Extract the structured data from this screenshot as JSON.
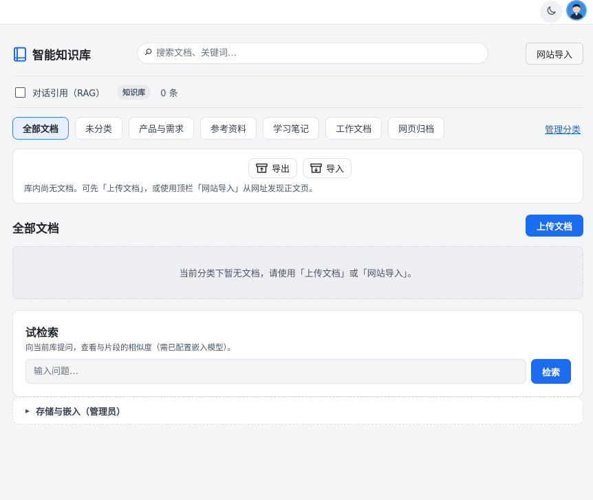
{
  "topbar": {
    "theme_icon": "moon-icon",
    "avatar_icon": "user-avatar"
  },
  "header": {
    "title": "智能知识库",
    "logo_icon": "book-icon",
    "search_placeholder": "搜索文档、关键词…",
    "search_icon": "search-icon",
    "site_import_label": "网站导入"
  },
  "rag": {
    "label": "对话引用（RAG）",
    "checked": false,
    "badge": "知识库",
    "count": "0 条"
  },
  "tabs": [
    {
      "label": "全部文档",
      "active": true
    },
    {
      "label": "未分类",
      "active": false
    },
    {
      "label": "产品与需求",
      "active": false
    },
    {
      "label": "参考资料",
      "active": false
    },
    {
      "label": "学习笔记",
      "active": false
    },
    {
      "label": "工作文档",
      "active": false
    },
    {
      "label": "网页归档",
      "active": false
    }
  ],
  "manage_categories_label": "管理分类",
  "io": {
    "export_label": "导出",
    "export_icon": "export-box-icon",
    "import_label": "导入",
    "import_icon": "import-box-icon",
    "hint": "库内尚无文档。可先「上传文档」，或使用顶栏「网站导入」从网址发现正文页。"
  },
  "docs": {
    "section_title": "全部文档",
    "upload_label": "上传文档",
    "empty_text": "当前分类下暂无文档，请使用「上传文档」或「网站导入」。"
  },
  "trial_search": {
    "title": "试检索",
    "description": "向当前库提问，查看与片段的相似度（需已配置嵌入模型）。",
    "input_placeholder": "输入问题…",
    "button_label": "检索"
  },
  "storage": {
    "label": "存储与嵌入（管理员）",
    "toggle_icon": "triangle-right-icon"
  },
  "colors": {
    "accent": "#1a6cf0",
    "link": "#1a66d4",
    "active_tab_bg": "#e8effc",
    "page_bg": "#f4f5f7"
  }
}
